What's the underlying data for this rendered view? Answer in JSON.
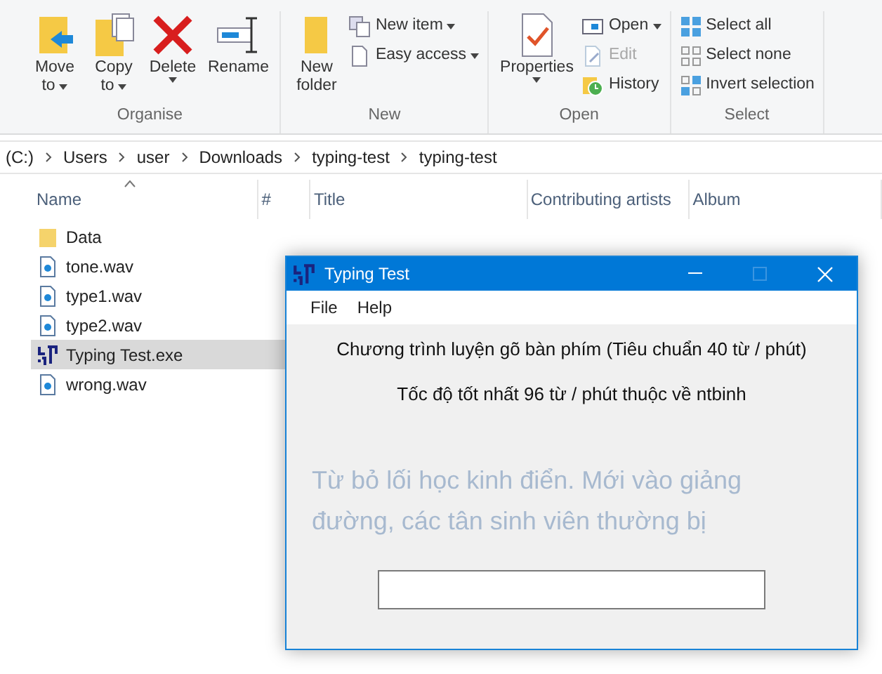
{
  "ribbon": {
    "groups": [
      {
        "label": "Organise",
        "commands": [
          {
            "kind": "move",
            "lines": [
              "Move",
              "to"
            ],
            "dropdown": true
          },
          {
            "kind": "copy",
            "lines": [
              "Copy",
              "to"
            ],
            "dropdown": true
          },
          {
            "kind": "delete",
            "lines": [
              "Delete"
            ],
            "dropdown": true
          },
          {
            "kind": "rename",
            "lines": [
              "Rename"
            ],
            "dropdown": false
          }
        ]
      },
      {
        "label": "New",
        "commands": [
          {
            "kind": "folder",
            "lines": [
              "New",
              "folder"
            ],
            "dropdown": false
          }
        ],
        "small": [
          {
            "kind": "newitem",
            "label": "New item",
            "dropdown": true,
            "disabled": false
          },
          {
            "kind": "easy",
            "label": "Easy access",
            "dropdown": true,
            "disabled": false
          }
        ]
      },
      {
        "label": "Open",
        "commands": [
          {
            "kind": "properties",
            "lines": [
              "Properties"
            ],
            "dropdown": true
          }
        ],
        "small": [
          {
            "kind": "open",
            "label": "Open",
            "dropdown": true,
            "disabled": false
          },
          {
            "kind": "edit",
            "label": "Edit",
            "dropdown": false,
            "disabled": true
          },
          {
            "kind": "history",
            "label": "History",
            "dropdown": false,
            "disabled": false
          }
        ]
      },
      {
        "label": "Select",
        "small": [
          {
            "kind": "selall",
            "label": "Select all",
            "dropdown": false,
            "disabled": false
          },
          {
            "kind": "selnone",
            "label": "Select none",
            "dropdown": false,
            "disabled": false
          },
          {
            "kind": "invert",
            "label": "Invert selection",
            "dropdown": false,
            "disabled": false
          }
        ]
      }
    ]
  },
  "breadcrumb": [
    "(C:)",
    "Users",
    "user",
    "Downloads",
    "typing-test",
    "typing-test"
  ],
  "columns": [
    {
      "label": "Name",
      "sorted": true
    },
    {
      "label": "#",
      "sorted": false
    },
    {
      "label": "Title",
      "sorted": false
    },
    {
      "label": "Contributing artists",
      "sorted": false
    },
    {
      "label": "Album",
      "sorted": false
    }
  ],
  "files": [
    {
      "name": "Data",
      "kind": "folder",
      "selected": false
    },
    {
      "name": "tone.wav",
      "kind": "audio",
      "selected": false
    },
    {
      "name": "type1.wav",
      "kind": "audio",
      "selected": false
    },
    {
      "name": "type2.wav",
      "kind": "audio",
      "selected": false
    },
    {
      "name": "Typing Test.exe",
      "kind": "app",
      "selected": true
    },
    {
      "name": "wrong.wav",
      "kind": "audio",
      "selected": false
    }
  ],
  "dialog": {
    "title": "Typing Test",
    "menu": [
      "File",
      "Help"
    ],
    "lines": [
      "Chương trình luyện gõ bàn phím (Tiêu chuẩn 40 từ / phút)",
      "Tốc độ tốt nhất 96 từ / phút thuộc về ntbinh"
    ],
    "prompt": "Từ bỏ lối học kinh điển. Mới vào giảng đường, các tân sinh viên thường bị"
  }
}
